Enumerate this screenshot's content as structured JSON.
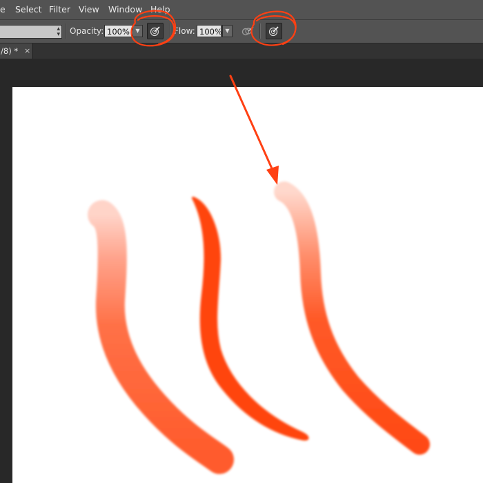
{
  "menubar": {
    "items": [
      "e",
      "Select",
      "Filter",
      "View",
      "Window",
      "Help"
    ]
  },
  "options": {
    "opacity_label": "Opacity:",
    "opacity_value": "100%",
    "flow_label": "Flow:",
    "flow_value": "100%"
  },
  "document": {
    "tab_title": "/8) *",
    "tab_close": "×"
  },
  "icons": {
    "pressure_opacity": "brush-pressure-icon",
    "airbrush": "airbrush-icon",
    "pressure_size": "brush-pressure-icon"
  },
  "colors": {
    "ui_panel": "#535353",
    "workspace": "#282828",
    "canvas": "#ffffff",
    "annotation": "#ff4013",
    "stroke_color": "#ff4a12"
  }
}
